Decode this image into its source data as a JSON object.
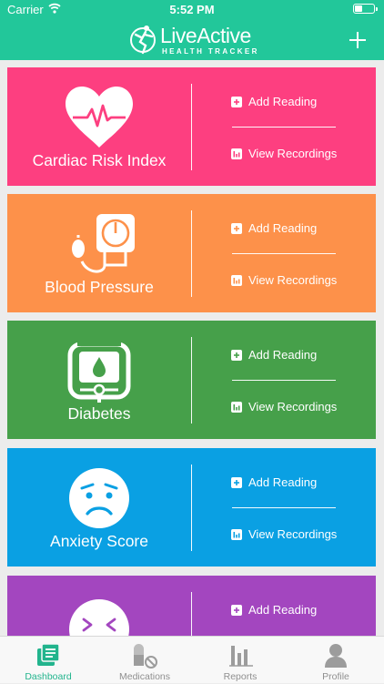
{
  "status": {
    "carrier": "Carrier",
    "time": "5:52 PM"
  },
  "header": {
    "logo_title": "LiveActive",
    "logo_subtitle": "HEALTH TRACKER"
  },
  "cards": [
    {
      "title": "Cardiac Risk Index",
      "add_label": "Add Reading",
      "view_label": "View Recordings",
      "color": "#fd3f80",
      "icon": "heart-pulse-icon"
    },
    {
      "title": "Blood Pressure",
      "add_label": "Add Reading",
      "view_label": "View Recordings",
      "color": "#fd914a",
      "icon": "blood-pressure-monitor-icon"
    },
    {
      "title": "Diabetes",
      "add_label": "Add Reading",
      "view_label": "View Recordings",
      "color": "#46a04a",
      "icon": "glucose-meter-icon"
    },
    {
      "title": "Anxiety Score",
      "add_label": "Add Reading",
      "view_label": "View Recordings",
      "color": "#0aa0e3",
      "icon": "worried-face-icon"
    },
    {
      "title": "",
      "add_label": "Add Reading",
      "view_label": "",
      "color": "#a346bf",
      "icon": "face-icon"
    }
  ],
  "tabs": [
    {
      "label": "Dashboard",
      "icon": "dashboard-icon",
      "active": true
    },
    {
      "label": "Medications",
      "icon": "pills-icon",
      "active": false
    },
    {
      "label": "Reports",
      "icon": "bar-chart-icon",
      "active": false
    },
    {
      "label": "Profile",
      "icon": "profile-icon",
      "active": false
    }
  ],
  "colors": {
    "brand": "#22c79a",
    "tab_active": "#22b48d",
    "tab_inactive": "#8f8f8f"
  }
}
